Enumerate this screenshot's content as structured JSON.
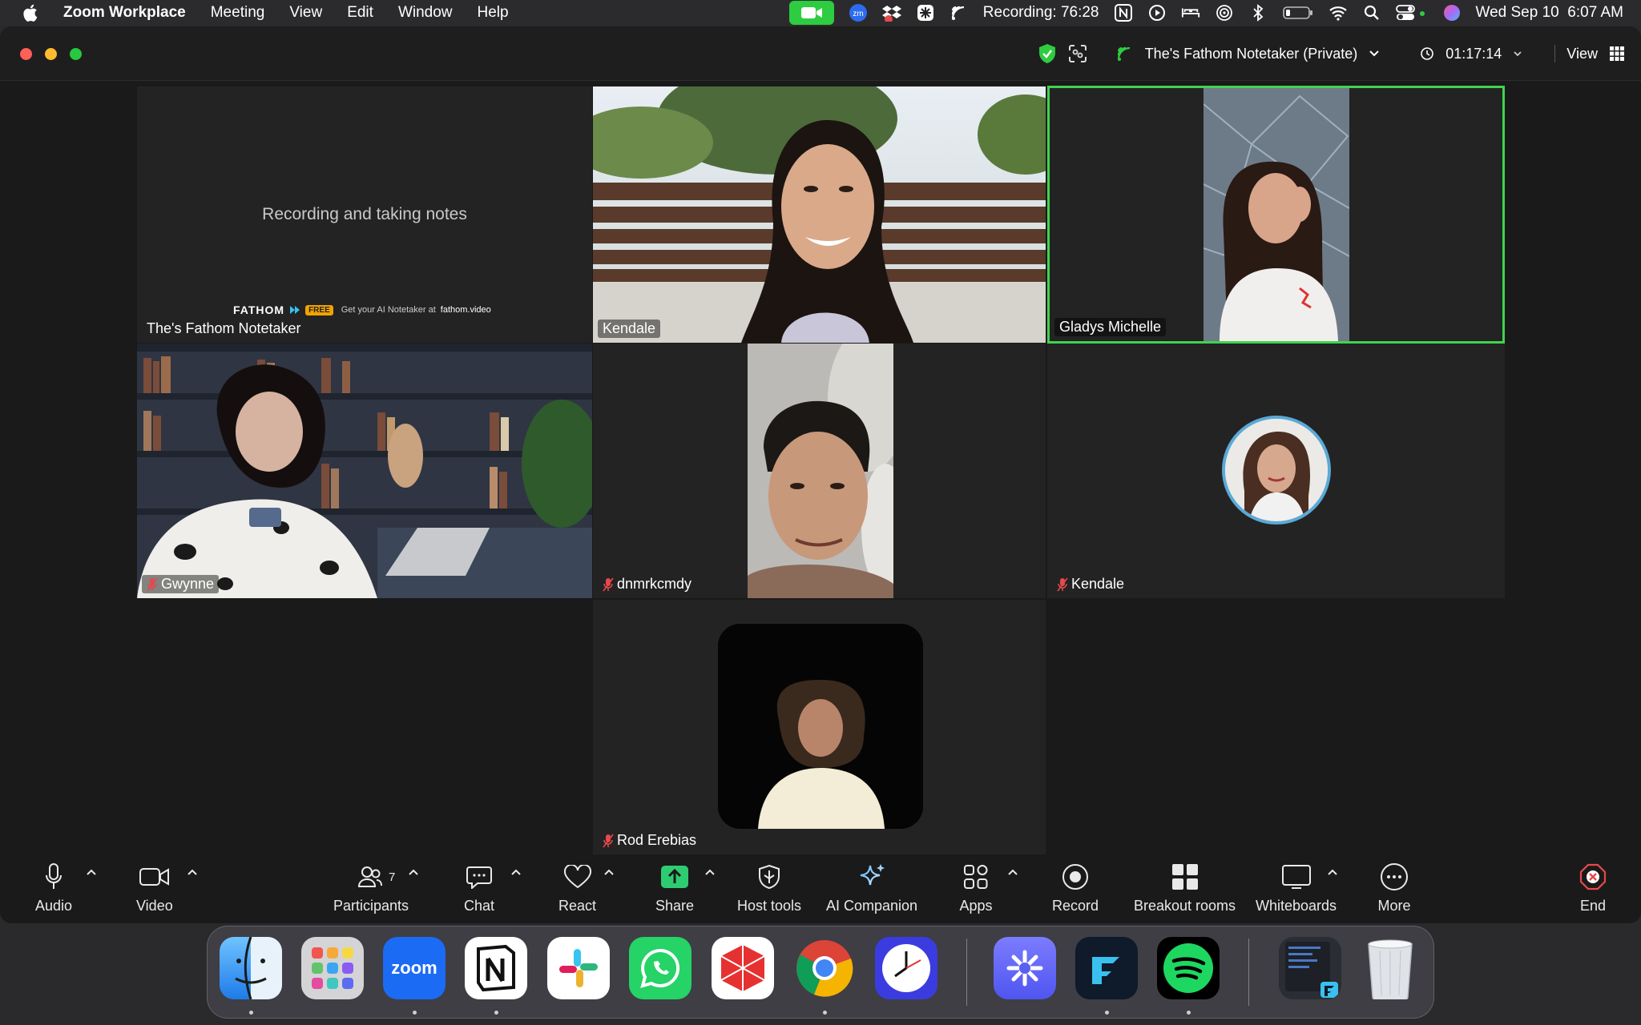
{
  "menubar": {
    "app_name": "Zoom Workplace",
    "items": [
      "Meeting",
      "View",
      "Edit",
      "Window",
      "Help"
    ],
    "recording": "Recording: 76:28",
    "datetime": "Wed Sep 10  6:07 AM"
  },
  "window": {
    "notetaker_label": "The's Fathom Notetaker (Private)",
    "timer": "01:17:14",
    "view_label": "View"
  },
  "tiles": {
    "fathom_center_text": "Recording and taking notes",
    "fathom_brand": "FATHOM",
    "fathom_free": "FREE",
    "fathom_promo_prefix": "Get your AI Notetaker at",
    "fathom_promo_link": "fathom.video",
    "names": [
      "The's Fathom Notetaker",
      "Kendale",
      "Gladys Michelle",
      "Gwynne",
      "dnmrkcmdy",
      "Kendale",
      "Rod Erebias"
    ]
  },
  "toolbar": {
    "audio": "Audio",
    "video": "Video",
    "participants": "Participants",
    "participants_count": "7",
    "chat": "Chat",
    "react": "React",
    "share": "Share",
    "host_tools": "Host tools",
    "ai_companion": "AI Companion",
    "apps": "Apps",
    "record": "Record",
    "breakout": "Breakout rooms",
    "whiteboards": "Whiteboards",
    "more": "More",
    "end": "End"
  },
  "dock": {
    "zoom_text": "zoom"
  },
  "colors": {
    "active_speaker": "#3fd44e",
    "share_green": "#2ecc71",
    "end_red": "#e5484d"
  }
}
